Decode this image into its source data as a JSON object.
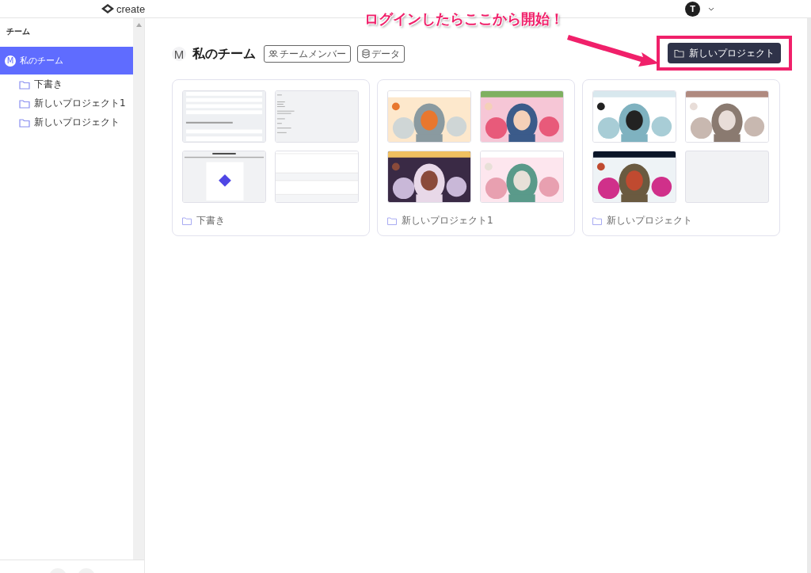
{
  "header": {
    "logo": "create",
    "user_avatar": "T"
  },
  "sidebar": {
    "heading": "チーム",
    "team": {
      "avatar": "M",
      "name": "私のチーム",
      "selected": true
    },
    "folders": [
      {
        "name": "下書き",
        "selected": false
      },
      {
        "name": "新しいプロジェクト1",
        "selected": false
      },
      {
        "name": "新しいプロジェクト",
        "selected": false
      }
    ]
  },
  "main": {
    "avatar": "M",
    "title": "私のチーム",
    "buttons": [
      {
        "label": "チームメンバー",
        "kind": "members"
      },
      {
        "label": "データ",
        "kind": "data"
      }
    ],
    "new_project": "新しいプロジェクト",
    "projects": [
      {
        "name": "下書き",
        "thumbnails": [
          {
            "kind": "form"
          },
          {
            "kind": "text"
          },
          {
            "kind": "diagram"
          },
          {
            "kind": "table"
          }
        ]
      },
      {
        "name": "新しいプロジェクト1",
        "thumbnails": [
          {
            "kind": "picture"
          },
          {
            "kind": "picture"
          },
          {
            "kind": "picture"
          },
          {
            "kind": "picture"
          }
        ]
      },
      {
        "name": "新しいプロジェクト",
        "thumbnails": [
          {
            "kind": "picture"
          },
          {
            "kind": "picture"
          },
          {
            "kind": "picture"
          },
          {
            "kind": "blank"
          }
        ]
      }
    ]
  },
  "annotation": {
    "text": "ログインしたらここから開始！"
  }
}
